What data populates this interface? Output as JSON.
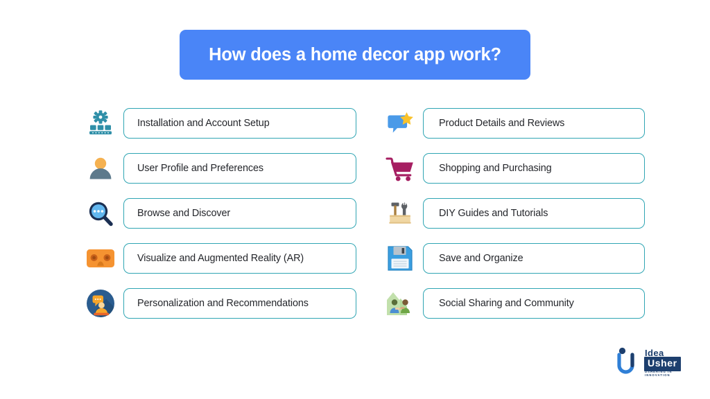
{
  "banner": {
    "title": "How does a home decor app work?",
    "background_color": "#4a85f7",
    "text_color": "#ffffff"
  },
  "theme": {
    "pill_border_color": "#2fa5b3",
    "pill_background": "#ffffff",
    "text_color": "#24262b",
    "page_background": "#ffffff"
  },
  "columns": {
    "left": {
      "items": [
        {
          "label": "Installation and Account Setup",
          "icon": "gear-server-setup-icon"
        },
        {
          "label": "User Profile and Preferences",
          "icon": "user-profile-icon"
        },
        {
          "label": "Browse and Discover",
          "icon": "magnifying-glass-icon"
        },
        {
          "label": "Visualize and Augmented Reality (AR)",
          "icon": "vr-goggles-icon"
        },
        {
          "label": "Personalization and Recommendations",
          "icon": "person-chat-bubble-icon"
        }
      ]
    },
    "right": {
      "items": [
        {
          "label": "Product Details and Reviews",
          "icon": "speech-bubble-star-icon"
        },
        {
          "label": "Shopping and Purchasing",
          "icon": "shopping-cart-icon"
        },
        {
          "label": "DIY Guides and Tutorials",
          "icon": "toolbox-hammer-wrench-icon"
        },
        {
          "label": "Save and Organize",
          "icon": "floppy-disk-icon"
        },
        {
          "label": "Social Sharing and Community",
          "icon": "handshake-community-icon"
        }
      ]
    }
  },
  "logo": {
    "brand_idea": "Idea",
    "brand_usher": "Usher",
    "tagline": "USHERING IN INNOVATION",
    "color": "#1d3f6e"
  }
}
